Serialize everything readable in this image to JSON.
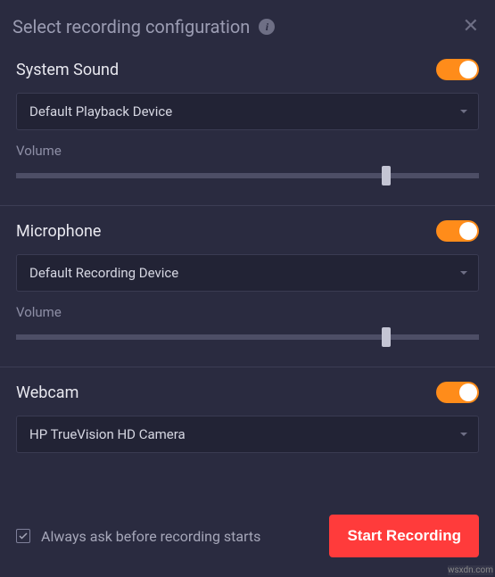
{
  "header": {
    "title": "Select recording configuration"
  },
  "sections": {
    "systemSound": {
      "title": "System Sound",
      "toggle": true,
      "device": "Default Playback Device",
      "volumeLabel": "Volume",
      "volumePercent": 80
    },
    "microphone": {
      "title": "Microphone",
      "toggle": true,
      "device": "Default Recording Device",
      "volumeLabel": "Volume",
      "volumePercent": 80
    },
    "webcam": {
      "title": "Webcam",
      "toggle": true,
      "device": "HP TrueVision HD Camera"
    }
  },
  "footer": {
    "checkboxLabel": "Always ask before recording starts",
    "checkboxChecked": true,
    "startButton": "Start Recording"
  },
  "watermark": "wsxdn.com"
}
